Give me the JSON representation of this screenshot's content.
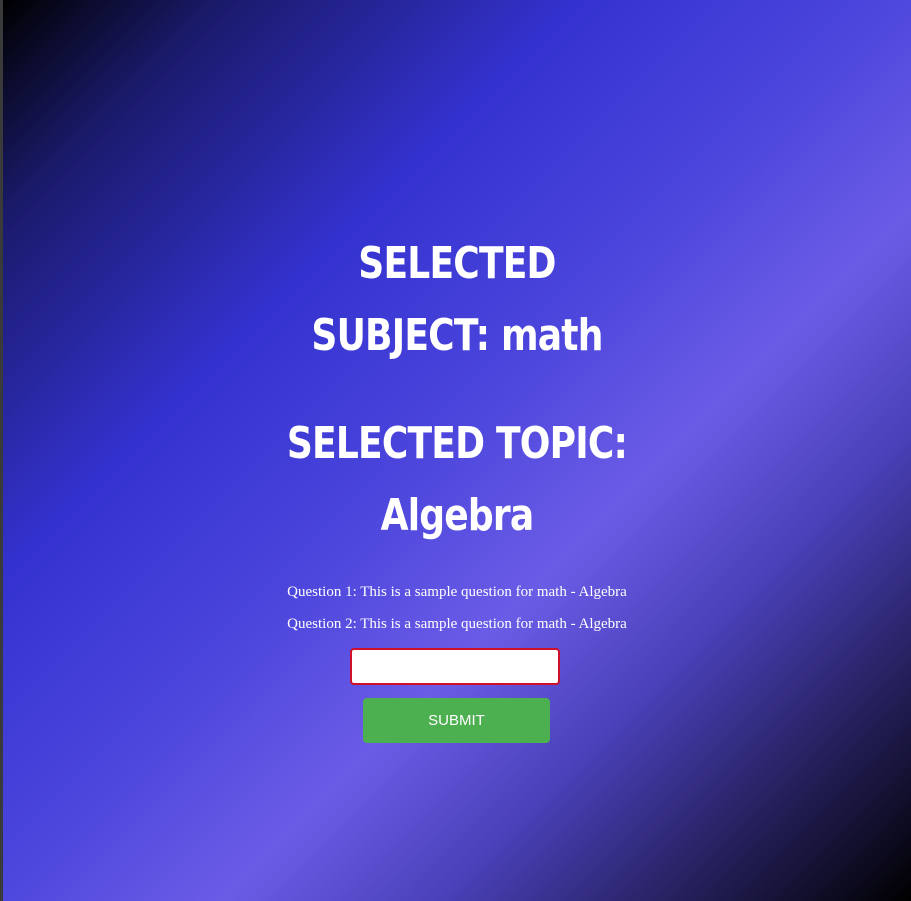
{
  "selection": {
    "subject_line1": "SELECTED",
    "subject_line2": "SUBJECT: math",
    "topic_line1": "SELECTED TOPIC:",
    "topic_line2": "Algebra"
  },
  "questions": [
    {
      "text": "Question 1: This is a sample question for math - Algebra"
    },
    {
      "text": "Question 2: This is a sample question for math - Algebra"
    }
  ],
  "answer": {
    "value": "",
    "placeholder": ""
  },
  "submit": {
    "label": "SUBMIT"
  },
  "colors": {
    "submit_button": "#4caf50",
    "input_border": "#d0102a",
    "text": "#ffffff",
    "background_mid": "#3432d0",
    "background_light": "#6b5ce6"
  }
}
